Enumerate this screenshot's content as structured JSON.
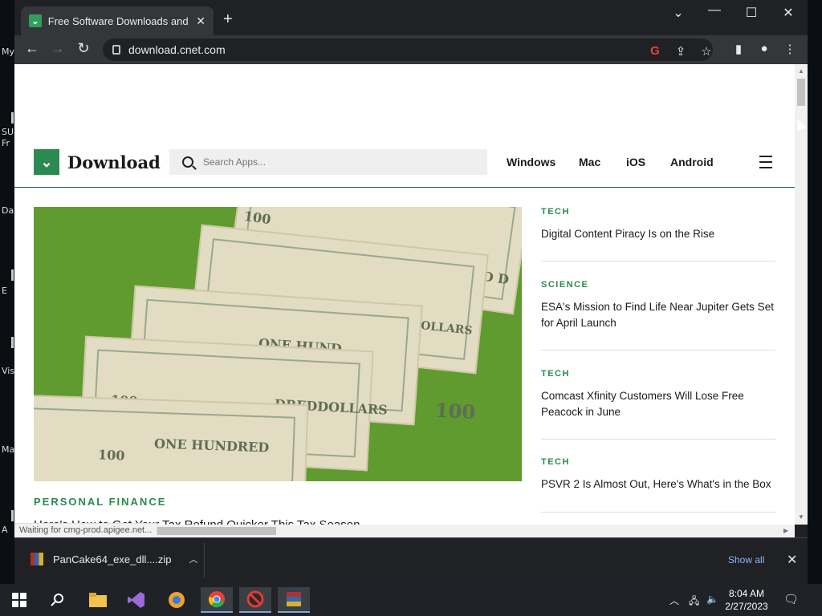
{
  "desktop": {
    "labels": [
      "My",
      "SU",
      "Fr",
      "Da",
      "E",
      "Vis",
      "Ma",
      "A"
    ]
  },
  "browser": {
    "tab": {
      "title": "Free Software Downloads and Re",
      "favicon": "download-logo-icon"
    },
    "omnibox": {
      "url": "download.cnet.com"
    },
    "colors": {
      "frame": "#202124",
      "toolbar": "#35363a",
      "accent": "#8ab4f8"
    }
  },
  "site": {
    "logo": {
      "text": "Download"
    },
    "search": {
      "placeholder": "Search Apps..."
    },
    "nav": [
      "Windows",
      "Mac",
      "iOS",
      "Android"
    ],
    "colors": {
      "brand_green": "#2b8a4f",
      "header_rule": "#1f5e43"
    }
  },
  "hero": {
    "bill_texts": [
      "100",
      "ONE HUNDRED D",
      "100",
      "ONE HUNDRED DOLLARS",
      "100",
      "ONE HUND",
      "100",
      "DREDDOLLARS",
      "100",
      "ONE HUNDRED",
      "100"
    ],
    "category": "PERSONAL FINANCE",
    "headline": "Here's How to Get Your Tax Refund Quicker This Tax Season"
  },
  "sidebar": {
    "items": [
      {
        "category": "TECH",
        "title": "Digital Content Piracy Is on the Rise"
      },
      {
        "category": "SCIENCE",
        "title": "ESA's Mission to Find Life Near Jupiter Gets Set for April Launch"
      },
      {
        "category": "TECH",
        "title": "Comcast Xfinity Customers Will Lose Free Peacock in June"
      },
      {
        "category": "TECH",
        "title": "PSVR 2 Is Almost Out, Here's What's in the Box"
      }
    ]
  },
  "status": {
    "text": "Waiting for cmg-prod.apigee.net..."
  },
  "downloads": {
    "file": "PanCake64_exe_dll....zip",
    "show_all": "Show all"
  },
  "taskbar": {
    "time": "8:04 AM",
    "date": "2/27/2023"
  }
}
